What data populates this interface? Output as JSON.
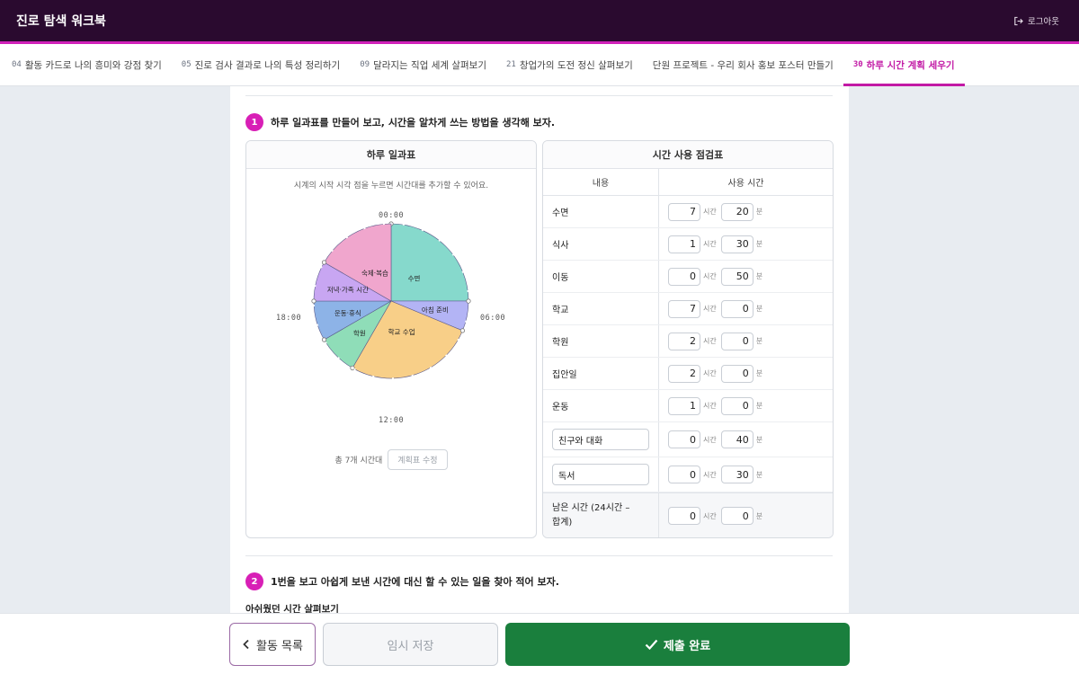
{
  "app": {
    "title": "진로 탐색 워크북",
    "logout_label": "로그아웃"
  },
  "tabs": [
    {
      "num": "04",
      "label": "활동 카드로 나의 흥미와 강점 찾기",
      "active": false
    },
    {
      "num": "05",
      "label": "진로 검사 결과로 나의 특성 정리하기",
      "active": false
    },
    {
      "num": "09",
      "label": "달라지는 직업 세계 살펴보기",
      "active": false
    },
    {
      "num": "21",
      "label": "창업가의 도전 정신 살펴보기",
      "active": false
    },
    {
      "num": "",
      "label": "단원 프로젝트 - 우리 회사 홍보 포스터 만들기",
      "active": false
    },
    {
      "num": "30",
      "label": "하루 시간 계획 세우기",
      "active": true
    }
  ],
  "q1": {
    "number": "1",
    "text": "하루 일과표를 만들어 보고, 시간을 알차게 쓰는 방법을 생각해 보자."
  },
  "schedule": {
    "title": "하루 일과표",
    "hint": "시계의 시작 시각 점을 누르면 시간대를 추가할 수 있어요.",
    "clock_labels": {
      "top": "00:00",
      "right": "06:00",
      "bottom": "12:00",
      "left": "18:00"
    },
    "summary": "총 7개 시간대",
    "edit_button": "계획표 수정",
    "segments": [
      {
        "label": "수면",
        "start": "00:00",
        "end": "06:00",
        "color": "#86d9cc"
      },
      {
        "label": "아침 준비",
        "start": "06:00",
        "end": "07:30",
        "color": "#b3b4f5"
      },
      {
        "label": "학교 수업",
        "start": "07:30",
        "end": "14:00",
        "color": "#f8cf88"
      },
      {
        "label": "학원",
        "start": "14:00",
        "end": "16:00",
        "color": "#8fddb8"
      },
      {
        "label": "운동·휴식",
        "start": "16:00",
        "end": "18:00",
        "color": "#8db3e7"
      },
      {
        "label": "저녁·가족 시간",
        "start": "18:00",
        "end": "20:00",
        "color": "#c8a6f2"
      },
      {
        "label": "숙제·복습",
        "start": "20:00",
        "end": "24:00",
        "color": "#f0a6cd"
      }
    ]
  },
  "checklist": {
    "title": "시간 사용 점검표",
    "col_content": "내용",
    "col_time": "사용 시간",
    "hour_unit": "시간",
    "minute_unit": "분",
    "rows": [
      {
        "label": "수면",
        "hours": "7",
        "minutes": "20",
        "editable_label": false
      },
      {
        "label": "식사",
        "hours": "1",
        "minutes": "30",
        "editable_label": false
      },
      {
        "label": "이동",
        "hours": "0",
        "minutes": "50",
        "editable_label": false
      },
      {
        "label": "학교",
        "hours": "7",
        "minutes": "0",
        "editable_label": false
      },
      {
        "label": "학원",
        "hours": "2",
        "minutes": "0",
        "editable_label": false
      },
      {
        "label": "집안일",
        "hours": "2",
        "minutes": "0",
        "editable_label": false
      },
      {
        "label": "운동",
        "hours": "1",
        "minutes": "0",
        "editable_label": false
      },
      {
        "label": "친구와 대화",
        "hours": "0",
        "minutes": "40",
        "editable_label": true
      },
      {
        "label": "독서",
        "hours": "0",
        "minutes": "30",
        "editable_label": true
      }
    ],
    "total": {
      "label_line1": "남은 시간 (24시간 –",
      "label_line2": "합계)",
      "hours": "0",
      "minutes": "0"
    }
  },
  "q2": {
    "number": "2",
    "text": "1번을 보고 아쉽게 보낸 시간에 대신 할 수 있는 일을 찾아 적어 보자."
  },
  "q2_subhead": "아쉬웠던 시간 살펴보기",
  "footer": {
    "list_label": "활동 목록",
    "save_label": "임시 저장",
    "submit_label": "제출 완료"
  }
}
